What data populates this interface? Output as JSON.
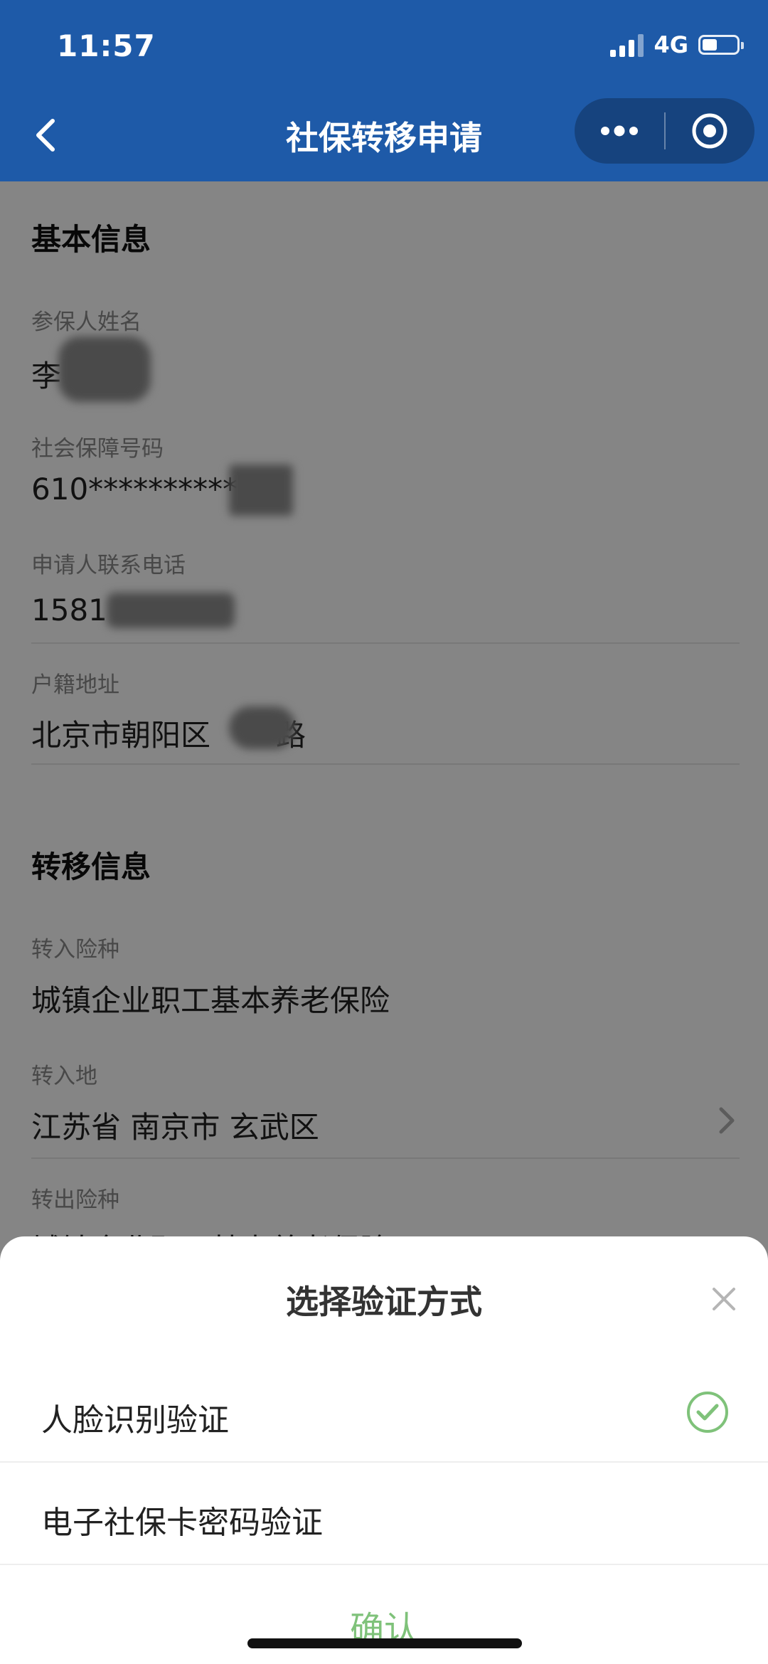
{
  "status_bar": {
    "time": "11:57",
    "network": "4G"
  },
  "nav": {
    "title": "社保转移申请"
  },
  "basic_info": {
    "section_title": "基本信息",
    "name_label": "参保人姓名",
    "name_value": "李",
    "ssn_label": "社会保障号码",
    "ssn_value": "610***********",
    "phone_label": "申请人联系电话",
    "phone_value": "1581",
    "address_label": "户籍地址",
    "address_prefix": "北京市朝阳区",
    "address_suffix": "路"
  },
  "transfer_info": {
    "section_title": "转移信息",
    "insurance_in_label": "转入险种",
    "insurance_in_value": "城镇企业职工基本养老保险",
    "place_in_label": "转入地",
    "place_in_value": "江苏省 南京市 玄武区",
    "insurance_out_label": "转出险种",
    "insurance_out_value": "城镇企业职工基本养老保险"
  },
  "sheet": {
    "title": "选择验证方式",
    "options": [
      {
        "label": "人脸识别验证",
        "selected": true
      },
      {
        "label": "电子社保卡密码验证",
        "selected": false
      }
    ],
    "confirm_label": "确认"
  },
  "colors": {
    "header_bg": "#1e5aa8",
    "accent_green": "#7fc27a"
  }
}
